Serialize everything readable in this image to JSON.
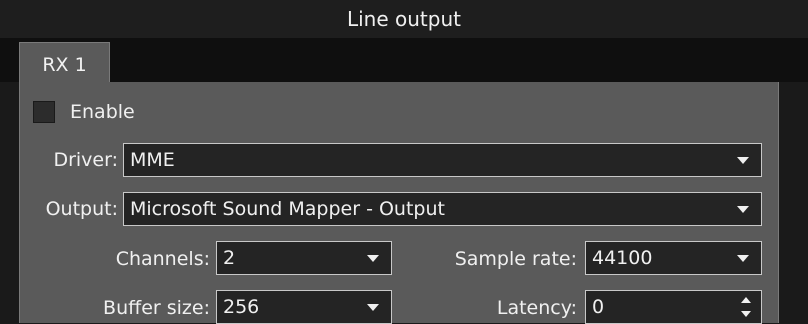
{
  "window": {
    "title": "Line output"
  },
  "tabs": [
    {
      "label": "RX 1",
      "active": true
    }
  ],
  "enable": {
    "label": "Enable",
    "checked": false
  },
  "driver": {
    "label": "Driver:",
    "value": "MME"
  },
  "output": {
    "label": "Output:",
    "value": "Microsoft Sound Mapper - Output"
  },
  "channels": {
    "label": "Channels:",
    "value": "2"
  },
  "sample_rate": {
    "label": "Sample rate:",
    "value": "44100"
  },
  "buffer_size": {
    "label": "Buffer size:",
    "value": "256"
  },
  "latency": {
    "label": "Latency:",
    "value": "0"
  },
  "colors": {
    "panel": "#5a5a5a",
    "field": "#242424",
    "border": "#c8c8c8",
    "text": "#f0f0f0"
  }
}
